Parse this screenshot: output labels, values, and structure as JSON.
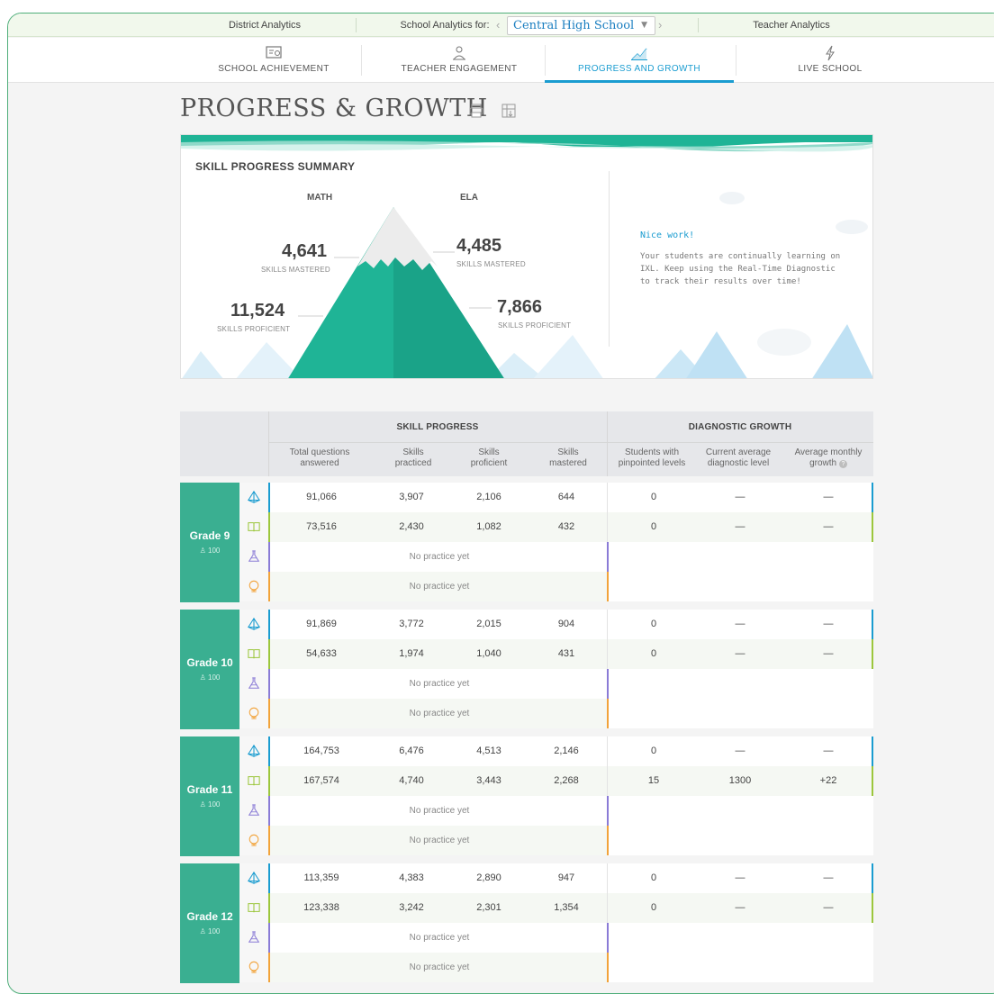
{
  "topnav": {
    "district": "District Analytics",
    "school_label": "School Analytics for:",
    "school_name": "Central High School",
    "teacher": "Teacher Analytics"
  },
  "tabs": [
    {
      "label": "SCHOOL ACHIEVEMENT",
      "icon": "certificate-icon",
      "active": false
    },
    {
      "label": "TEACHER ENGAGEMENT",
      "icon": "teacher-icon",
      "active": false
    },
    {
      "label": "PROGRESS AND GROWTH",
      "icon": "growth-chart-icon",
      "active": true
    },
    {
      "label": "LIVE SCHOOL",
      "icon": "lightning-icon",
      "active": false
    }
  ],
  "page": {
    "title": "PROGRESS & GROWTH"
  },
  "summary": {
    "title": "SKILL PROGRESS SUMMARY",
    "math": {
      "label": "MATH",
      "mastered": "4,641",
      "mastered_label": "SKILLS MASTERED",
      "proficient": "11,524",
      "proficient_label": "SKILLS PROFICIENT"
    },
    "ela": {
      "label": "ELA",
      "mastered": "4,485",
      "mastered_label": "SKILLS MASTERED",
      "proficient": "7,866",
      "proficient_label": "SKILLS PROFICIENT"
    },
    "message_title": "Nice work!",
    "message": "Your students are continually learning on IXL. Keep using the Real-Time Diagnostic to track their results over time!"
  },
  "table": {
    "group_progress": "SKILL PROGRESS",
    "group_growth": "DIAGNOSTIC GROWTH",
    "columns": {
      "questions": "Total questions answered",
      "practiced": "Skills practiced",
      "proficient": "Skills proficient",
      "mastered": "Skills mastered",
      "pinpointed": "Students with pinpointed levels",
      "avg_level": "Current average diagnostic level",
      "monthly_growth": "Average monthly growth"
    },
    "no_practice": "No practice yet",
    "grades": [
      {
        "name": "Grade 9",
        "students": "100",
        "math": [
          "91,066",
          "3,907",
          "2,106",
          "644",
          "0",
          "—",
          "—"
        ],
        "ela": [
          "73,516",
          "2,430",
          "1,082",
          "432",
          "0",
          "—",
          "—"
        ]
      },
      {
        "name": "Grade 10",
        "students": "100",
        "math": [
          "91,869",
          "3,772",
          "2,015",
          "904",
          "0",
          "—",
          "—"
        ],
        "ela": [
          "54,633",
          "1,974",
          "1,040",
          "431",
          "0",
          "—",
          "—"
        ]
      },
      {
        "name": "Grade 11",
        "students": "100",
        "math": [
          "164,753",
          "6,476",
          "4,513",
          "2,146",
          "0",
          "—",
          "—"
        ],
        "ela": [
          "167,574",
          "4,740",
          "3,443",
          "2,268",
          "15",
          "1300",
          "+22"
        ]
      },
      {
        "name": "Grade 12",
        "students": "100",
        "math": [
          "113,359",
          "4,383",
          "2,890",
          "947",
          "0",
          "—",
          "—"
        ],
        "ela": [
          "123,338",
          "3,242",
          "2,301",
          "1,354",
          "0",
          "—",
          "—"
        ]
      }
    ]
  },
  "colors": {
    "accent": "#1a9cd0",
    "grade_green": "#3aaf91",
    "mountain": "#1fb496",
    "math": "#1a9cd0",
    "ela": "#9cc63d",
    "science": "#8a7bd6",
    "social_studies": "#f2a33a"
  }
}
